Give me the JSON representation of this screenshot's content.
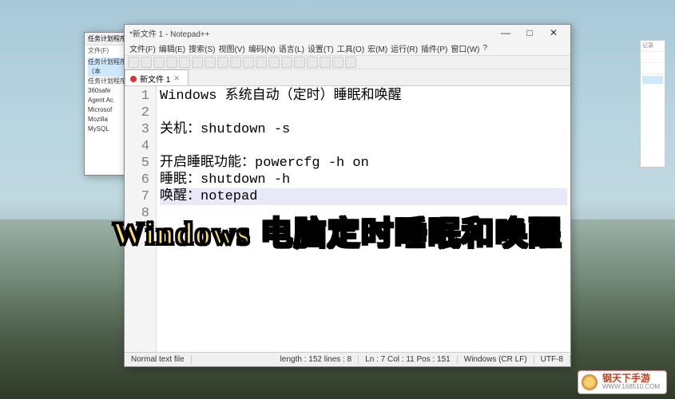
{
  "background_window": {
    "title": "任务计划程序",
    "subtitle": "文件(F)",
    "tree": {
      "root": "任务计划程序（本",
      "items": [
        "任务计划程序",
        "360safe",
        "Agent Ac",
        "Microsof",
        "Mozilla",
        "MySQL"
      ]
    }
  },
  "right_panel": {
    "label": "记录"
  },
  "notepadpp": {
    "title": "*新文件 1 - Notepad++",
    "menu": [
      "文件(F)",
      "编辑(E)",
      "搜索(S)",
      "视图(V)",
      "编码(N)",
      "语言(L)",
      "设置(T)",
      "工具(O)",
      "宏(M)",
      "运行(R)",
      "插件(P)",
      "窗口(W)",
      "?"
    ],
    "tab": {
      "label": "新文件 1"
    },
    "line_numbers": [
      "1",
      "2",
      "3",
      "4",
      "5",
      "6",
      "7",
      "8"
    ],
    "code_lines": [
      "Windows 系统自动（定时）睡眠和唤醒",
      "",
      "关机：shutdown -s",
      "",
      "开启睡眠功能：powercfg -h on",
      "睡眠：shutdown -h",
      "唤醒：notepad",
      ""
    ],
    "current_line_index": 6,
    "status": {
      "left": "Normal text file",
      "length": "length : 152   lines : 8",
      "pos": "Ln : 7   Col : 11   Pos : 151",
      "eol": "Windows (CR LF)",
      "enc": "UTF-8"
    },
    "window_buttons": {
      "min": "—",
      "max": "□",
      "close": "✕"
    }
  },
  "overlay": {
    "title": "Windows 电脑定时睡眠和唤醒"
  },
  "watermark": {
    "line1": "钢天下手游",
    "line2": "WWW.168510.COM"
  }
}
